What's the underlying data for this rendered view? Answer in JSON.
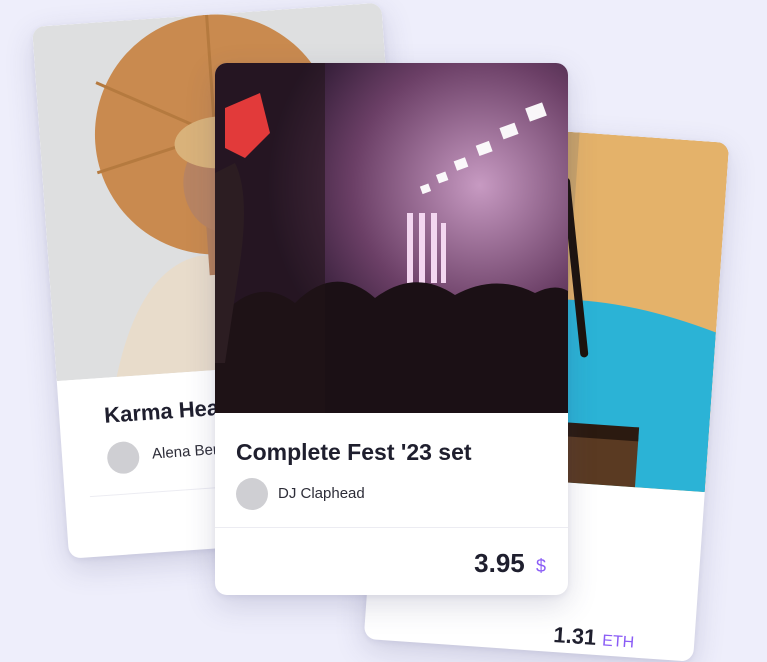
{
  "cards": [
    {
      "title": "Karma Head",
      "author": "Alena Bergson",
      "image": "portrait-woman-sun-hat-image"
    },
    {
      "title": "Complete Fest '23 set",
      "author": "DJ Claphead",
      "price": "3.95",
      "currency": "$",
      "image": "concert-crowd-image"
    },
    {
      "price": "1.31",
      "currency": "ETH",
      "image": "musician-dreadlocks-image"
    }
  ],
  "colors": {
    "background": "#eeeefb",
    "accent": "#8a5cf6",
    "avatar_placeholder": "#cfcfd3"
  }
}
